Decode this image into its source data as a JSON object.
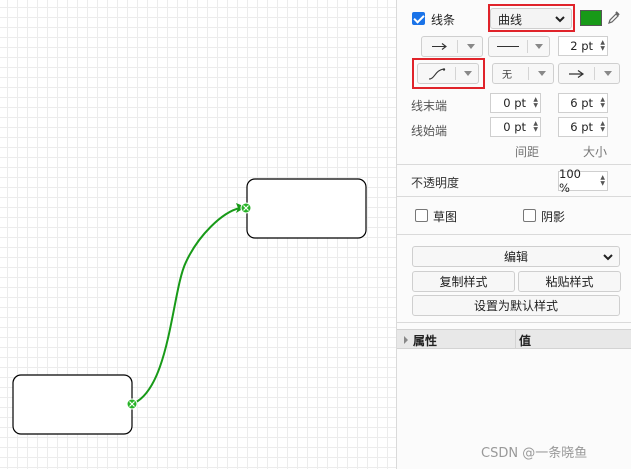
{
  "panel": {
    "line_label": "线条",
    "line_style_value": "曲线",
    "line_color": "#189a18",
    "line_width": "2 pt",
    "waypoint_value": "无",
    "line_end_label": "线末端",
    "line_start_label": "线始端",
    "end_spacing": "0 pt",
    "end_size": "6 pt",
    "start_spacing": "0 pt",
    "start_size": "6 pt",
    "spacing_caption": "间距",
    "size_caption": "大小",
    "opacity_label": "不透明度",
    "opacity_value": "100 %",
    "sketch_label": "草图",
    "shadow_label": "阴影",
    "edit_label": "编辑",
    "copy_style_label": "复制样式",
    "paste_style_label": "粘贴样式",
    "set_default_label": "设置为默认样式",
    "prop_col_label": "属性",
    "value_col_label": "值"
  },
  "colors": {
    "connector": "#189a18",
    "highlight": "#e0232a",
    "accent": "#1a73e8"
  },
  "watermark": "CSDN @一条晓鱼"
}
